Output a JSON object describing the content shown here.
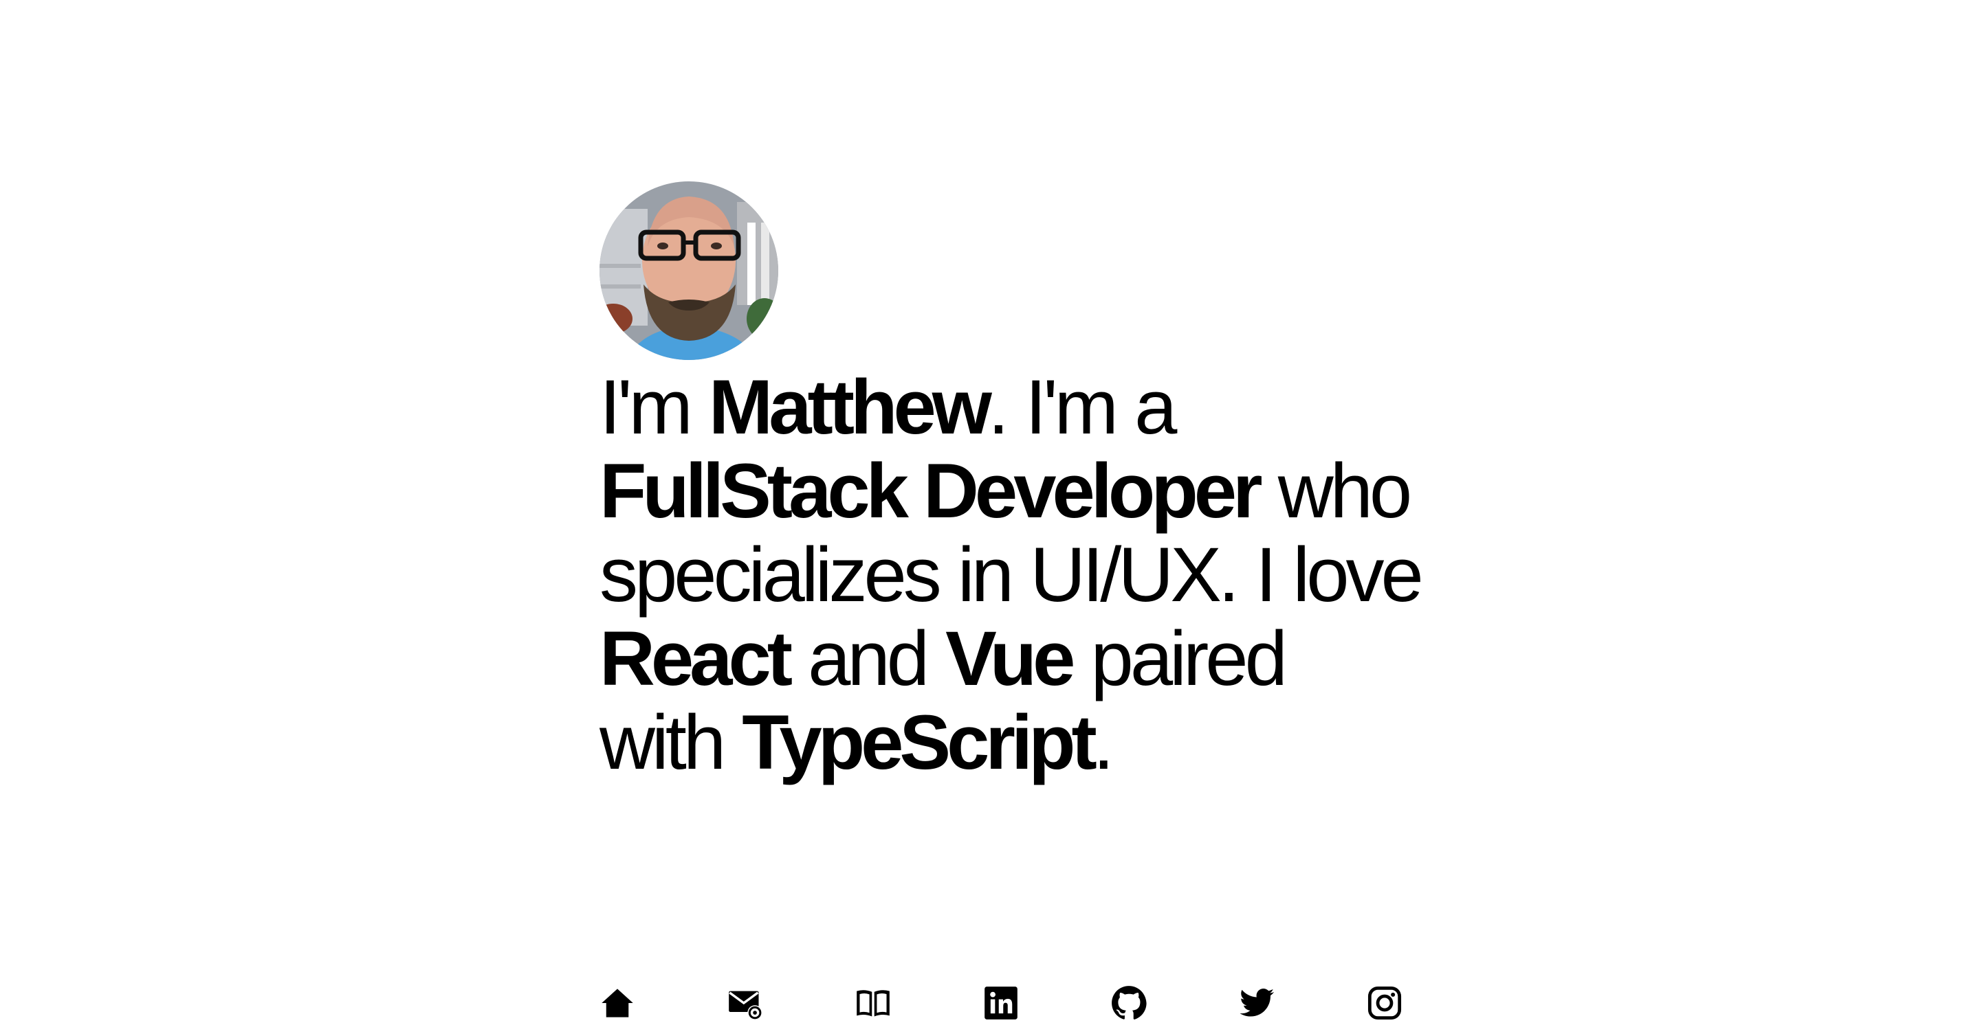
{
  "profile": {
    "name": "Matthew",
    "avatar_alt": "Matthew"
  },
  "intro": {
    "p1": "I'm ",
    "name": "Matthew",
    "p2": ". I'm a ",
    "role": "FullStack Developer",
    "p3": " who specializes in UI/UX. I love ",
    "lib1": "React",
    "p4": " and ",
    "lib2": "Vue",
    "p5": " paired with ",
    "lang": "TypeScript",
    "p6": "."
  },
  "nav": {
    "icons": [
      "home-icon",
      "email-icon",
      "book-icon",
      "linkedin-icon",
      "github-icon",
      "twitter-icon",
      "instagram-icon"
    ]
  },
  "colors": {
    "background": "#ffffff",
    "text": "#000000"
  }
}
